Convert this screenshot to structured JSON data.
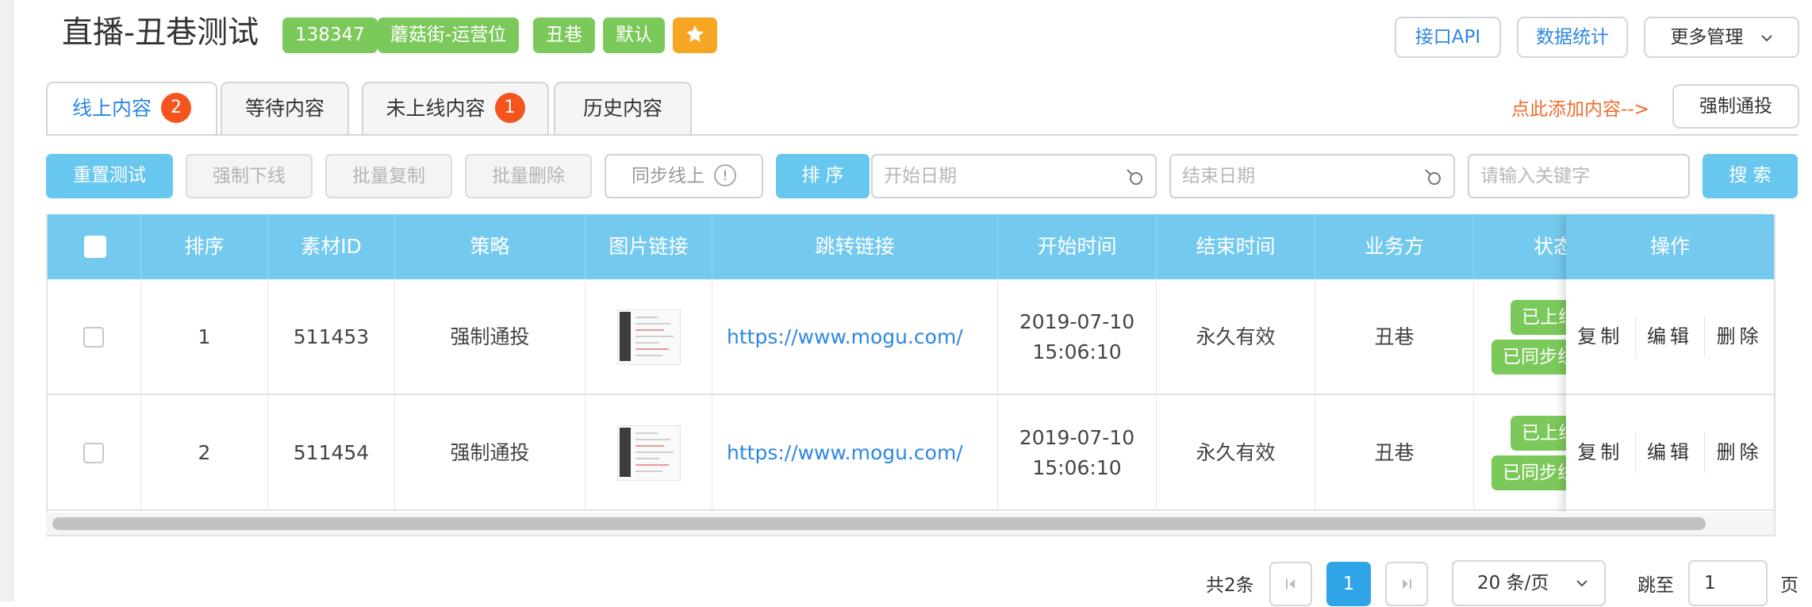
{
  "header": {
    "title": "直播-丑巷测试",
    "tags": [
      "138347",
      "蘑菇街-运营位",
      "丑巷",
      "默认"
    ],
    "star_icon": "star-icon",
    "buttons": {
      "api": "接口API",
      "stats": "数据统计",
      "more": "更多管理"
    }
  },
  "tabs": [
    {
      "label": "线上内容",
      "badge": "2"
    },
    {
      "label": "等待内容"
    },
    {
      "label": "未上线内容",
      "badge": "1"
    },
    {
      "label": "历史内容"
    }
  ],
  "add_hint": "点此添加内容-->",
  "force_push_button": "强制通投",
  "toolbar": {
    "reset_test": "重置测试",
    "force_offline": "强制下线",
    "batch_copy": "批量复制",
    "batch_delete": "批量删除",
    "sync_online": "同步线上",
    "help_mark": "!",
    "sort": "排 序",
    "start_date_placeholder": "开始日期",
    "end_date_placeholder": "结束日期",
    "keyword_placeholder": "请输入关键字",
    "search": "搜 索"
  },
  "table": {
    "columns": [
      "排序",
      "素材ID",
      "策略",
      "图片链接",
      "跳转链接",
      "开始时间",
      "结束时间",
      "业务方",
      "状态",
      "操作"
    ],
    "rows": [
      {
        "order": "1",
        "material_id": "511453",
        "strategy": "强制通投",
        "link": "https://www.mogu.com/",
        "start_date": "2019-07-10",
        "start_time": "15:06:10",
        "end": "永久有效",
        "business": "丑巷",
        "status_1": "已上线",
        "status_2": "已同步线上"
      },
      {
        "order": "2",
        "material_id": "511454",
        "strategy": "强制通投",
        "link": "https://www.mogu.com/",
        "start_date": "2019-07-10",
        "start_time": "15:06:10",
        "end": "永久有效",
        "business": "丑巷",
        "status_1": "已上线",
        "status_2": "已同步线上"
      }
    ],
    "actions": [
      "复制",
      "编辑",
      "删除"
    ]
  },
  "pagination": {
    "total": "共2条",
    "current_page": "1",
    "page_size": "20 条/页",
    "jump_label": "跳至",
    "jump_value": "1",
    "page_word": "页"
  },
  "colors": {
    "tag_green": "#7cc95b",
    "star_orange": "#f6a623",
    "header_blue": "#74c9ef",
    "link_blue": "#2d87e2",
    "badge_red": "#f5541e",
    "hint_orange": "#f26b2b"
  }
}
